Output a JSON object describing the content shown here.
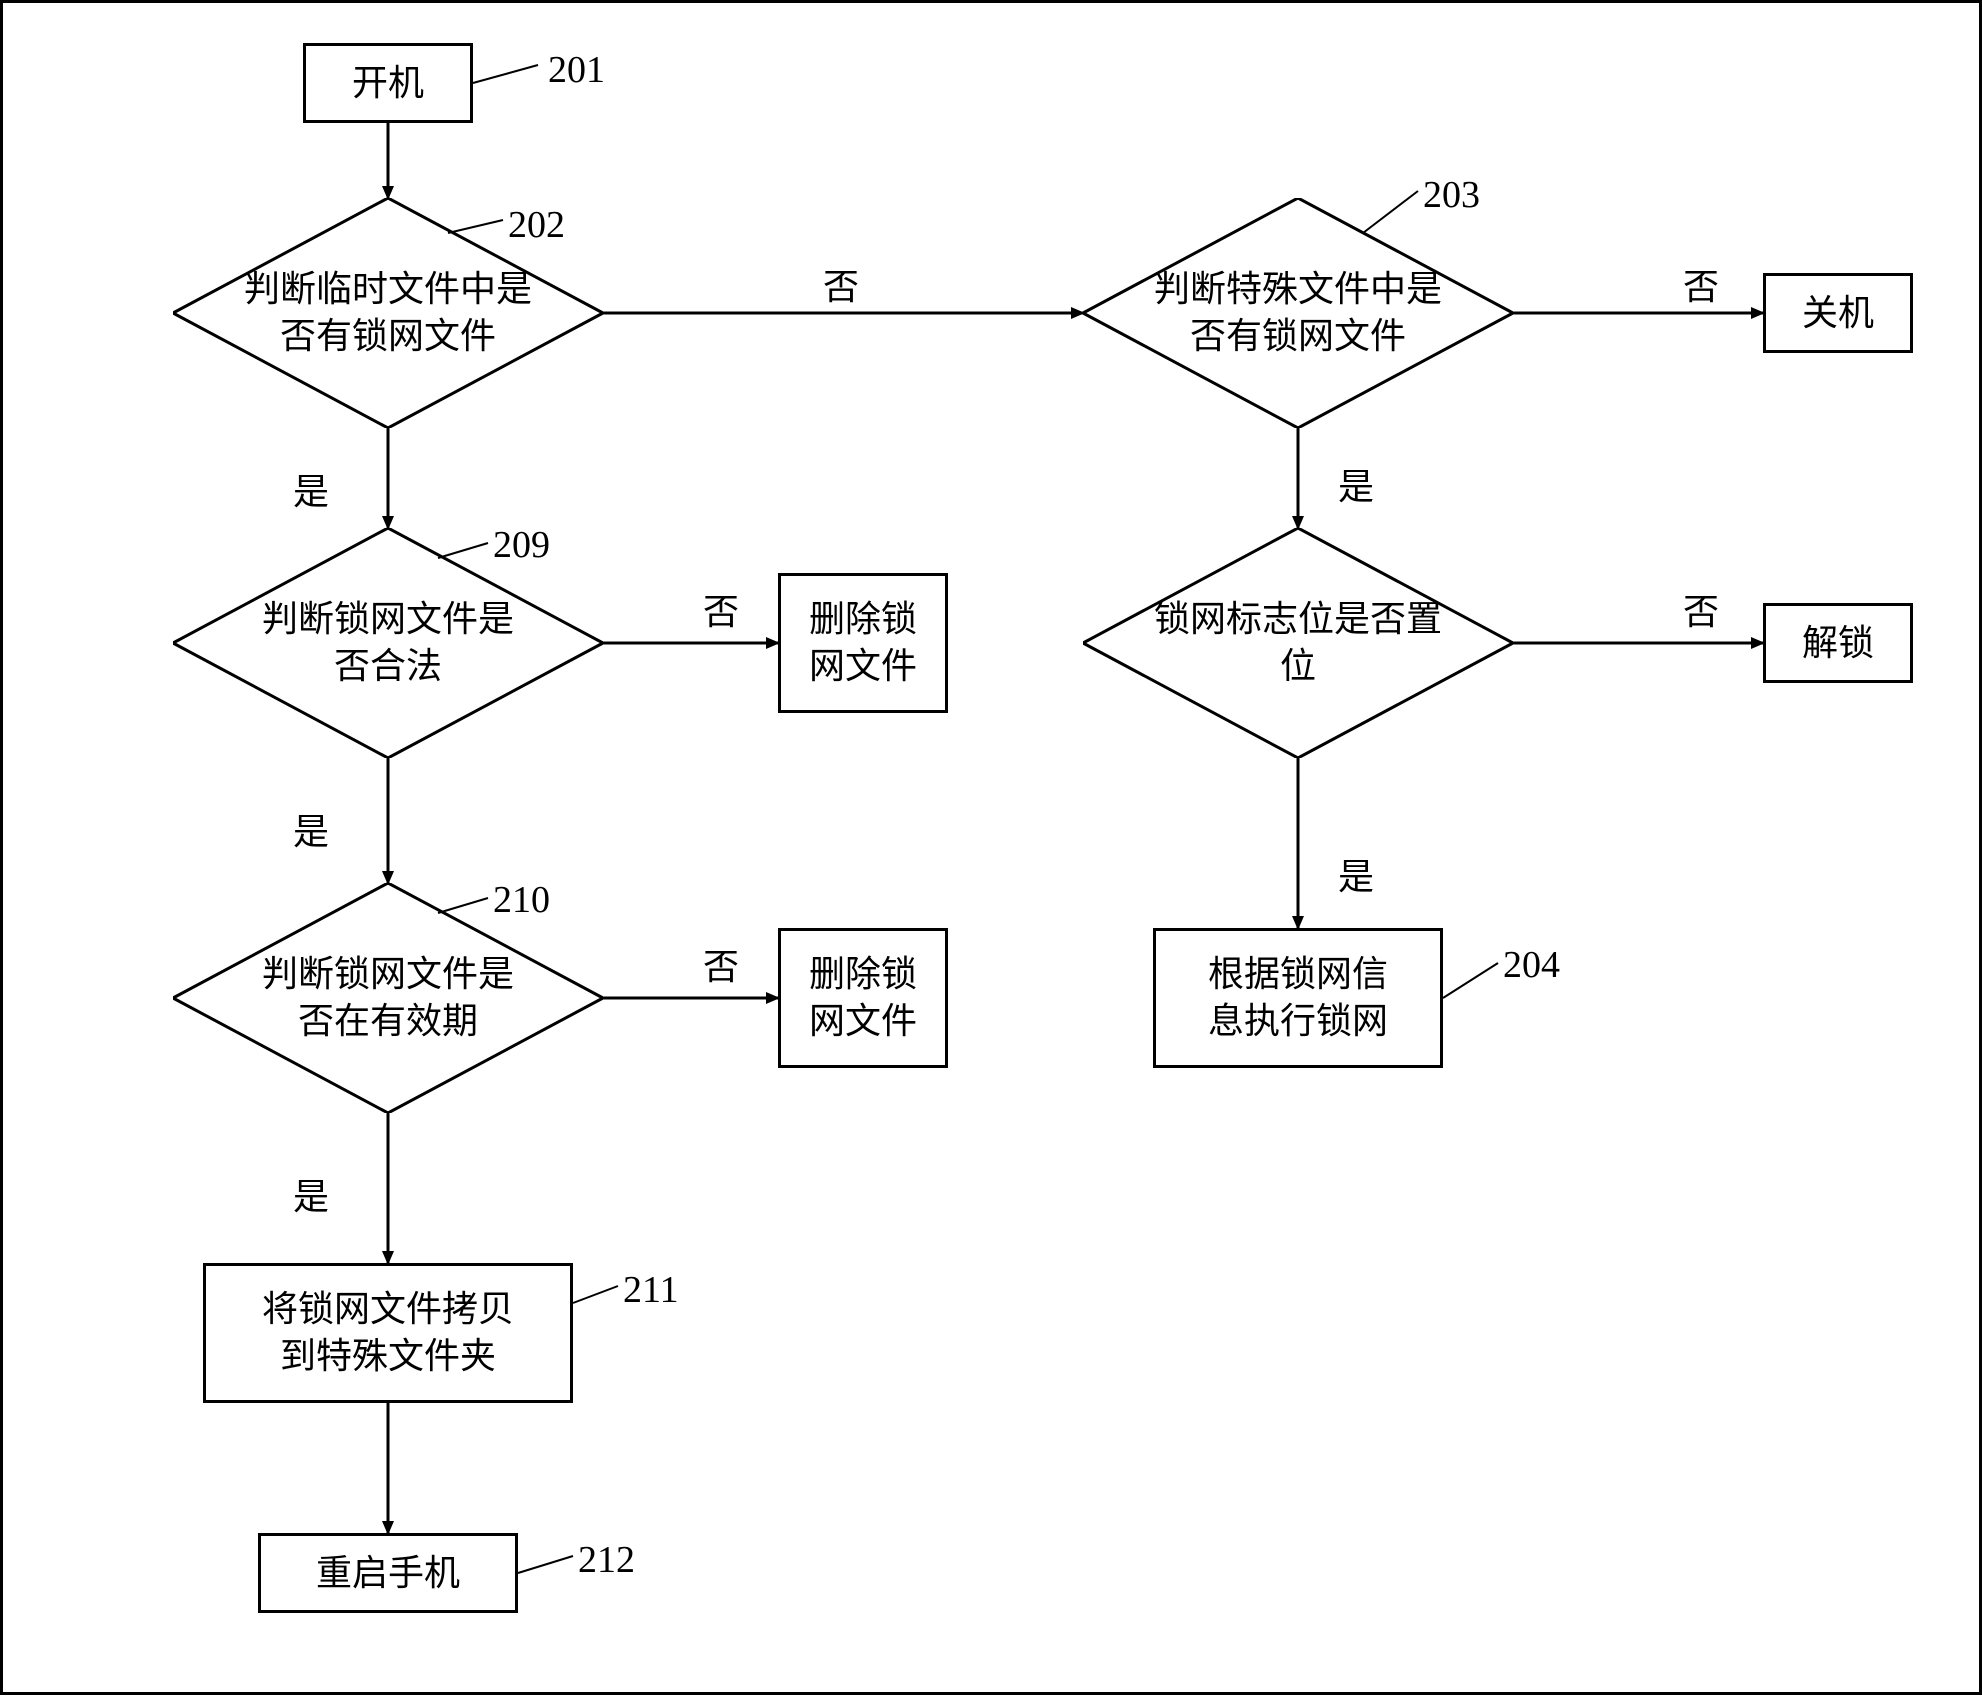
{
  "chart_data": {
    "type": "flowchart",
    "title": "",
    "nodes": [
      {
        "id": "201",
        "type": "process",
        "label": "开机"
      },
      {
        "id": "202",
        "type": "decision",
        "label": "判断临时文件中是否有锁网文件"
      },
      {
        "id": "203",
        "type": "decision",
        "label": "判断特殊文件中是否有锁网文件"
      },
      {
        "id": "shutdown",
        "type": "process",
        "label": "关机"
      },
      {
        "id": "flagset",
        "type": "decision",
        "label": "锁网标志位是否置位"
      },
      {
        "id": "unlock",
        "type": "process",
        "label": "解锁"
      },
      {
        "id": "204",
        "type": "process",
        "label": "根据锁网信息执行锁网"
      },
      {
        "id": "209",
        "type": "decision",
        "label": "判断锁网文件是否合法"
      },
      {
        "id": "del1",
        "type": "process",
        "label": "删除锁网文件"
      },
      {
        "id": "210",
        "type": "decision",
        "label": "判断锁网文件是否在有效期"
      },
      {
        "id": "del2",
        "type": "process",
        "label": "删除锁网文件"
      },
      {
        "id": "211",
        "type": "process",
        "label": "将锁网文件拷贝到特殊文件夹"
      },
      {
        "id": "212",
        "type": "process",
        "label": "重启手机"
      }
    ],
    "edges": [
      {
        "from": "201",
        "to": "202",
        "label": ""
      },
      {
        "from": "202",
        "to": "203",
        "label": "否"
      },
      {
        "from": "202",
        "to": "209",
        "label": "是"
      },
      {
        "from": "203",
        "to": "shutdown",
        "label": "否"
      },
      {
        "from": "203",
        "to": "flagset",
        "label": "是"
      },
      {
        "from": "flagset",
        "to": "unlock",
        "label": "否"
      },
      {
        "from": "flagset",
        "to": "204",
        "label": "是"
      },
      {
        "from": "209",
        "to": "del1",
        "label": "否"
      },
      {
        "from": "209",
        "to": "210",
        "label": "是"
      },
      {
        "from": "210",
        "to": "del2",
        "label": "否"
      },
      {
        "from": "210",
        "to": "211",
        "label": "是"
      },
      {
        "from": "211",
        "to": "212",
        "label": ""
      }
    ]
  },
  "nodes": {
    "n201": "开机",
    "n202": "判断临时文件中是\n否有锁网文件",
    "n203": "判断特殊文件中是\n否有锁网文件",
    "shutdown": "关机",
    "flagset": "锁网标志位是否置\n位",
    "unlock": "解锁",
    "n204": "根据锁网信\n息执行锁网",
    "n209": "判断锁网文件是\n否合法",
    "del1": "删除锁\n网文件",
    "n210": "判断锁网文件是\n否在有效期",
    "del2": "删除锁\n网文件",
    "n211": "将锁网文件拷贝\n到特殊文件夹",
    "n212": "重启手机"
  },
  "labels": {
    "yes": "是",
    "no": "否"
  },
  "steps": {
    "s201": "201",
    "s202": "202",
    "s203": "203",
    "s204": "204",
    "s209": "209",
    "s210": "210",
    "s211": "211",
    "s212": "212"
  }
}
